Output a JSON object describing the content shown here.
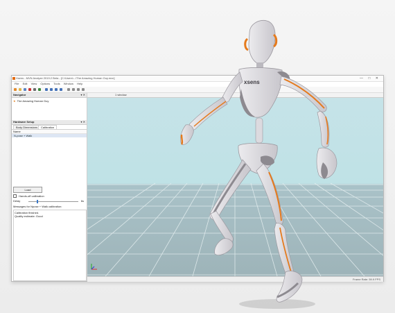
{
  "app": {
    "title": "Xsens - MVN Analyze 2019.2 Beta - [C:\\Users\\...\\The Amazing Human Guy.mvn]",
    "window_buttons": "— □ ✕",
    "menu": [
      "File",
      "Edit",
      "View",
      "Options",
      "Tools",
      "Window",
      "Help"
    ]
  },
  "navigator": {
    "title": "Navigator",
    "controls": "▾ ✕",
    "item": "The Amazing Human Guy"
  },
  "hardware_setup": {
    "title": "Hardware Setup",
    "controls": "▾ ✕",
    "tabs": [
      "Body Dimensions",
      "Calibration"
    ],
    "column_name": "Name",
    "row": "N-pose + Walk",
    "load_label": "Load",
    "hands_off_label": "Hands-off calibration",
    "delay_label": "Delay",
    "delay_value": "6s",
    "messages_label": "Messages for Npose + Walk calibration:",
    "messages": [
      "Calibration finished.",
      "Quality estimate: Good"
    ]
  },
  "viewport": {
    "window_label": "1 window"
  },
  "status": {
    "frame_rate": "Frame Rate: 59.9 FPS"
  },
  "colors": {
    "accent": "#e37b14",
    "sky": "#c6e3e8",
    "floor": "#a9c2c8",
    "figure_body": "#e3e1e5",
    "figure_shade": "#8d8a90",
    "figure_orange": "#e57a1c"
  },
  "figure_label": "xsens"
}
